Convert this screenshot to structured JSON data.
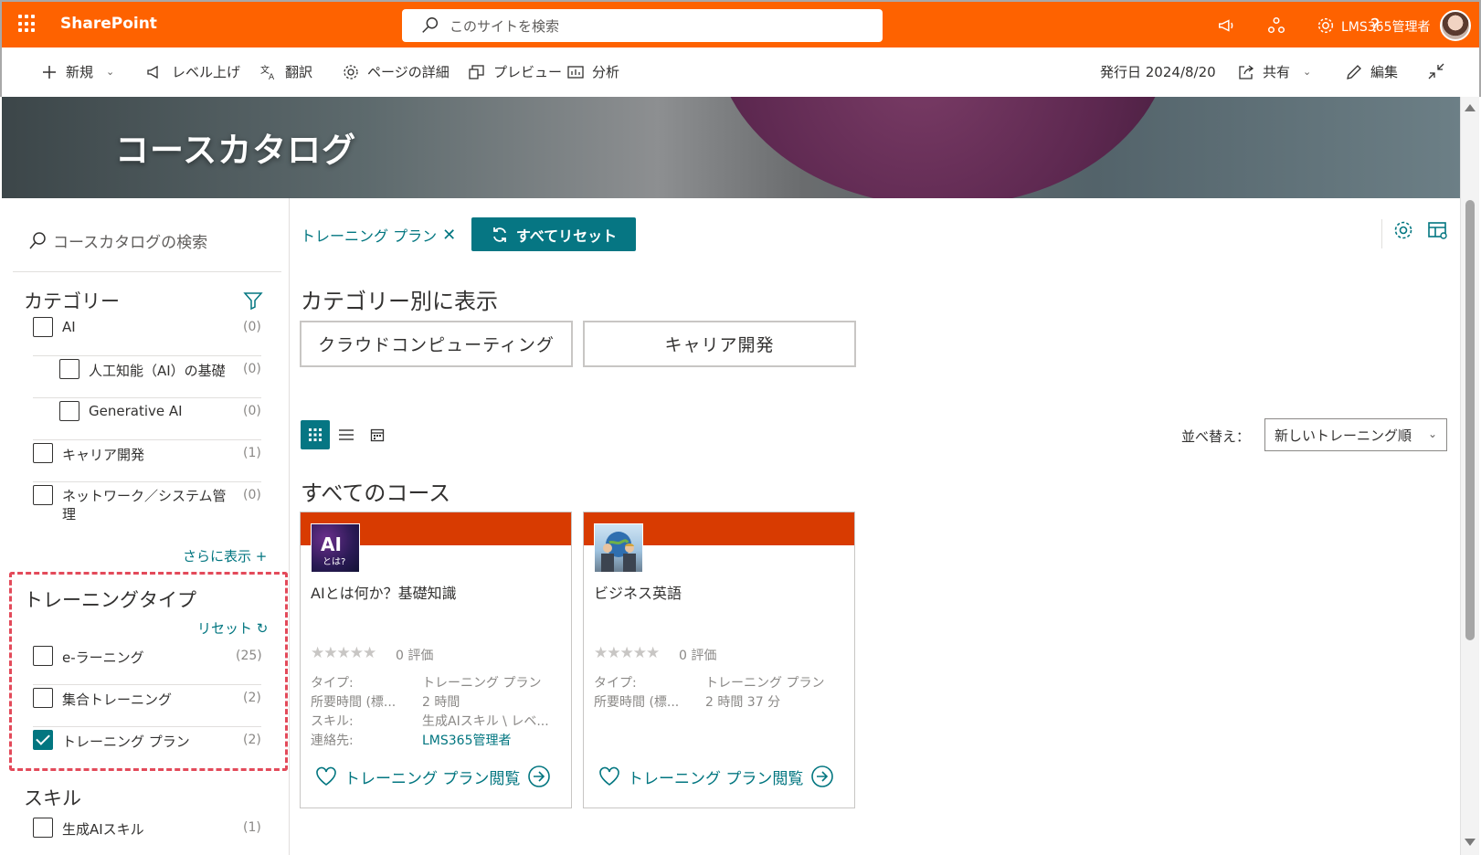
{
  "suite": {
    "brand": "SharePoint",
    "search_placeholder": "このサイトを検索",
    "user_name": "LMS365管理者"
  },
  "commandbar": {
    "new_label": "新規",
    "promote_label": "レベル上げ",
    "translate_label": "翻訳",
    "page_details_label": "ページの詳細",
    "preview_label": "プレビュー",
    "analytics_label": "分析",
    "published_label": "発行日 2024/8/20",
    "share_label": "共有",
    "edit_label": "編集"
  },
  "banner": {
    "title": "コースカタログ"
  },
  "filters": {
    "search_placeholder": "コースカタログの検索",
    "category": {
      "title": "カテゴリー",
      "items": [
        {
          "label": "AI",
          "count": "(0)",
          "checked": false
        },
        {
          "label": "人工知能（AI）の基礎",
          "count": "(0)",
          "checked": false
        },
        {
          "label": "Generative AI",
          "count": "(0)",
          "checked": false
        },
        {
          "label": "キャリア開発",
          "count": "(1)",
          "checked": false
        },
        {
          "label": "ネットワーク／システム管理",
          "count": "(0)",
          "checked": false
        }
      ],
      "show_more": "さらに表示"
    },
    "training_type": {
      "title": "トレーニングタイプ",
      "reset": "リセット",
      "items": [
        {
          "label": "e-ラーニング",
          "count": "(25)",
          "checked": false
        },
        {
          "label": "集合トレーニング",
          "count": "(2)",
          "checked": false
        },
        {
          "label": "トレーニング プラン",
          "count": "(2)",
          "checked": true
        }
      ]
    },
    "skills": {
      "title": "スキル",
      "items": [
        {
          "label": "生成AIスキル",
          "count": "(1)",
          "checked": false
        }
      ]
    }
  },
  "main": {
    "active_filter_chip": "トレーニング プラン",
    "reset_all": "すべてリセット",
    "by_category_title": "カテゴリー別に表示",
    "category_buttons": [
      "クラウドコンピューティング",
      "キャリア開発"
    ],
    "sort_label": "並べ替え：",
    "sort_value": "新しいトレーニング順",
    "all_courses_title": "すべてのコース",
    "cards": [
      {
        "title": "AIとは何か？基礎知識",
        "thumb_text": "AI",
        "thumb_sub": "とは?",
        "stars": "★★★★★",
        "rating": "0 評価",
        "meta_labels": [
          "タイプ:",
          "所要時間 (標...",
          "スキル:",
          "連絡先:"
        ],
        "meta_values": [
          "トレーニング プラン",
          "2 時間",
          "生成AIスキル \\ レベ...",
          "LMS365管理者"
        ],
        "action": "トレーニング プラン閲覧"
      },
      {
        "title": "ビジネス英語",
        "stars": "★★★★★",
        "rating": "0 評価",
        "meta_labels": [
          "タイプ:",
          "所要時間 (標..."
        ],
        "meta_values": [
          "トレーニング プラン",
          "2 時間 37 分"
        ],
        "action": "トレーニング プラン閲覧"
      }
    ]
  },
  "colors": {
    "suite_orange": "#fe6200",
    "teal": "#027680",
    "card_bar": "#d83b01",
    "highlight_box": "#e34a5a"
  }
}
